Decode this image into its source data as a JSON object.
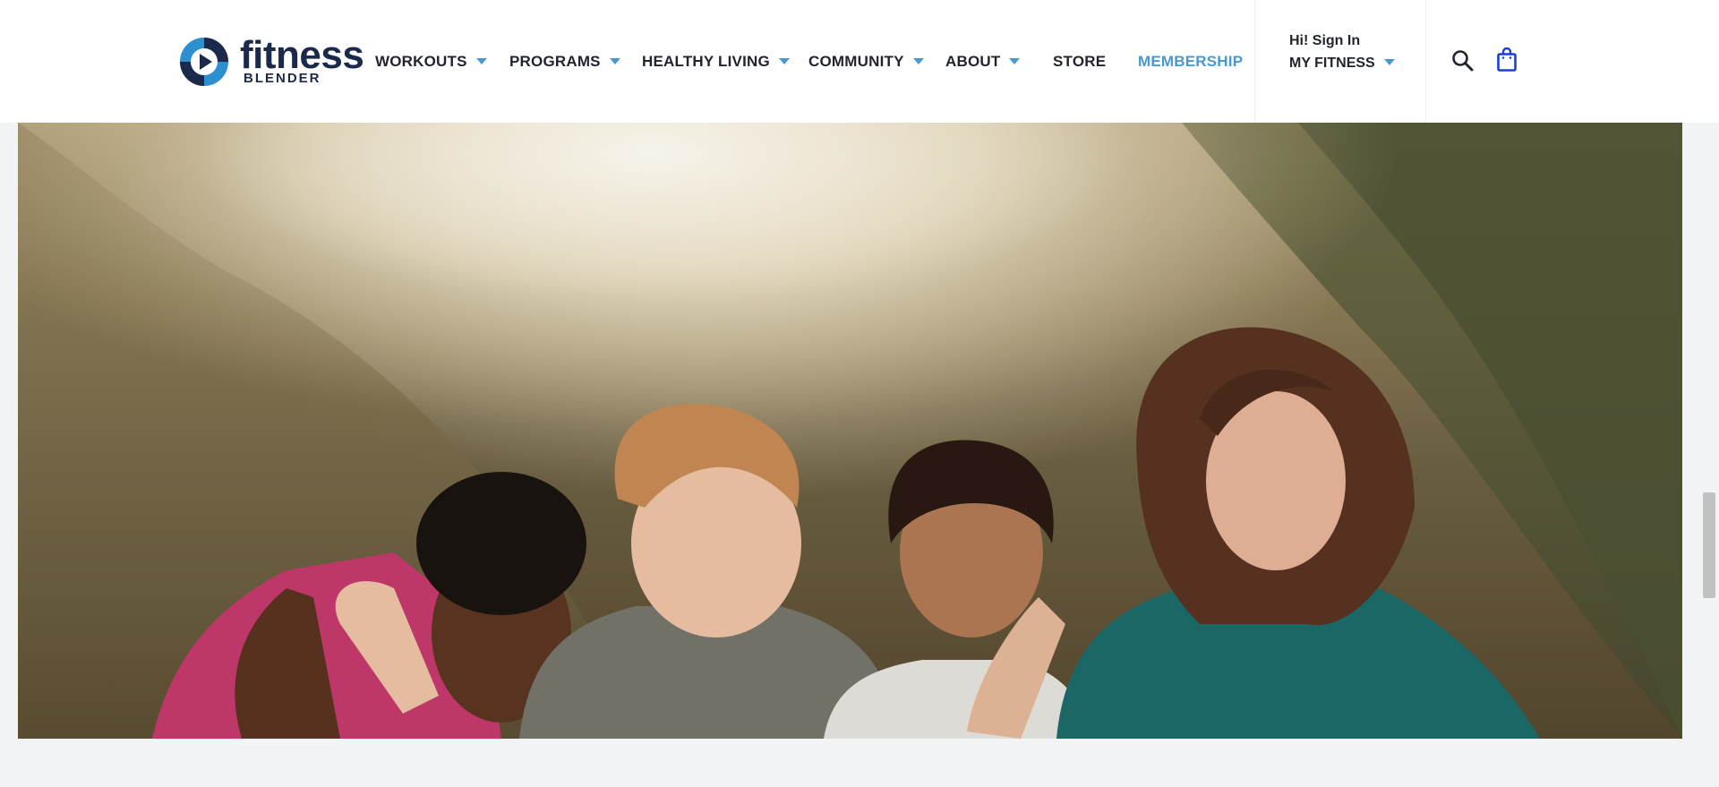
{
  "brand": {
    "name": "fitness",
    "sub": "BLENDER",
    "primary_color": "#1b2a4a",
    "accent_color": "#4a98cf"
  },
  "nav": {
    "items": [
      {
        "label": "WORKOUTS",
        "dropdown": true
      },
      {
        "label": "PROGRAMS",
        "dropdown": true
      },
      {
        "label": "HEALTHY LIVING",
        "dropdown": true
      },
      {
        "label": "COMMUNITY",
        "dropdown": true
      },
      {
        "label": "ABOUT",
        "dropdown": true
      },
      {
        "label": "STORE",
        "dropdown": false
      },
      {
        "label": "MEMBERSHIP",
        "dropdown": false
      }
    ]
  },
  "account": {
    "greeting": "Hi! Sign In",
    "menu_label": "MY FITNESS"
  },
  "icons": {
    "search": "search-icon",
    "cart": "shopping-bag-icon",
    "cart_color": "#1a3fd6"
  },
  "hero": {
    "image": "photo-four-women-laughing-on-hillside"
  }
}
